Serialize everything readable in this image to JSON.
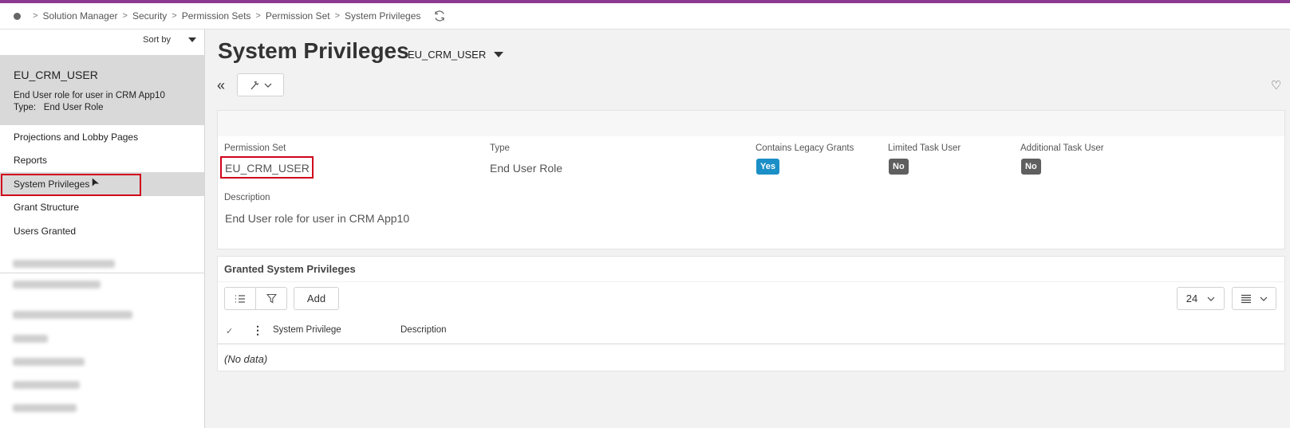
{
  "breadcrumb": {
    "items": [
      "Solution Manager",
      "Security",
      "Permission Sets",
      "Permission Set",
      "System Privileges"
    ]
  },
  "sidebar": {
    "sort_label": "Sort by",
    "selected": {
      "title": "EU_CRM_USER",
      "description": "End User role for user in CRM App10",
      "type_label": "Type:",
      "type_value": "End User Role"
    },
    "nav_items": [
      {
        "label": "Projections and Lobby Pages"
      },
      {
        "label": "Reports"
      },
      {
        "label": "System Privileges",
        "active": true
      },
      {
        "label": "Grant Structure"
      },
      {
        "label": "Users Granted"
      }
    ]
  },
  "header": {
    "title": "System Privileges",
    "subtitle": "EU_CRM_USER"
  },
  "details": {
    "permission_set_label": "Permission Set",
    "permission_set_value": "EU_CRM_USER",
    "type_label": "Type",
    "type_value": "End User Role",
    "legacy_label": "Contains Legacy Grants",
    "legacy_value": "Yes",
    "limited_label": "Limited Task User",
    "limited_value": "No",
    "additional_label": "Additional Task User",
    "additional_value": "No",
    "description_label": "Description",
    "description_value": "End User role for user in CRM App10"
  },
  "grid": {
    "title": "Granted System Privileges",
    "add_label": "Add",
    "page_size": "24",
    "columns": [
      "System Privilege",
      "Description"
    ],
    "empty_text": "(No data)"
  },
  "colors": {
    "accent_bar": "#8b3a8f",
    "yes_badge": "#1b8fc7",
    "no_badge": "#5f5f5f",
    "highlight": "#d0021b"
  }
}
